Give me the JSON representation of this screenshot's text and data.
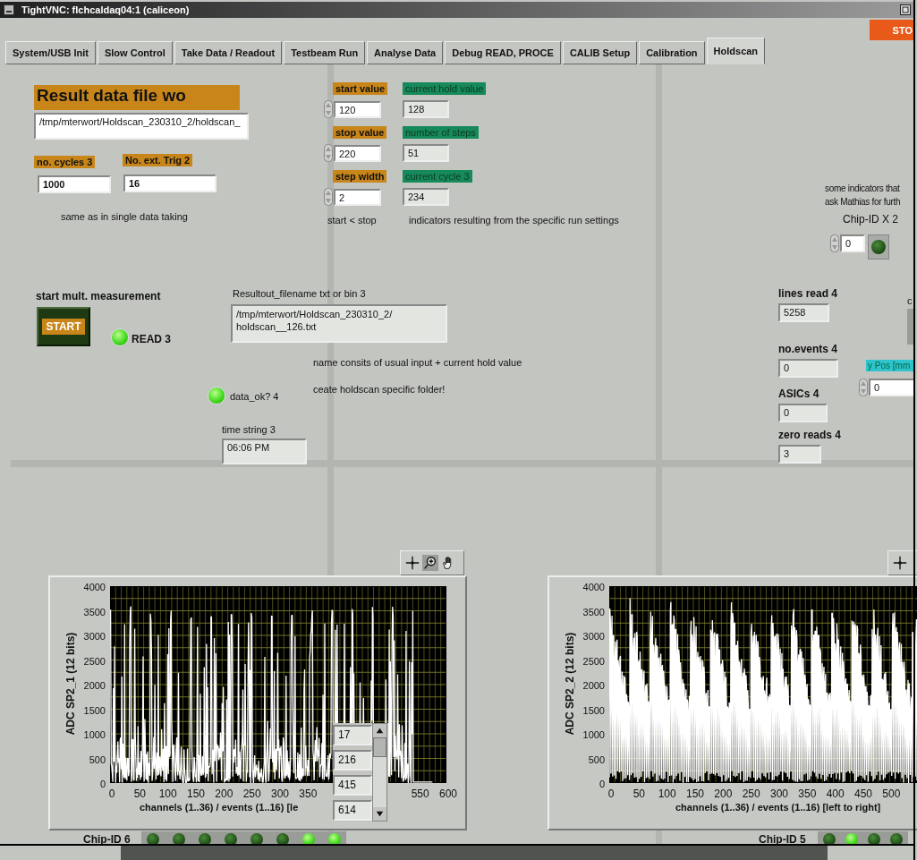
{
  "window": {
    "title": "TightVNC: flchcaldaq04:1 (caliceon)"
  },
  "tabs": [
    {
      "label": "System/USB Init",
      "selected": false
    },
    {
      "label": "Slow Control",
      "selected": false
    },
    {
      "label": "Take Data / Readout",
      "selected": false
    },
    {
      "label": "Testbeam Run",
      "selected": false
    },
    {
      "label": "Analyse Data",
      "selected": false
    },
    {
      "label": "Debug READ, PROCE",
      "selected": false
    },
    {
      "label": "CALIB Setup",
      "selected": false
    },
    {
      "label": "Calibration",
      "selected": false
    },
    {
      "label": "Holdscan",
      "selected": true
    }
  ],
  "stop_button": {
    "label": "STO"
  },
  "result_file": {
    "label": "Result data file wo",
    "value": "/tmp/mterwort/Holdscan_230310_2/holdscan_"
  },
  "no_cycles": {
    "label": "no. cycles 3",
    "value": "1000"
  },
  "ext_trig": {
    "label": "No. ext. Trig 2",
    "value": "16"
  },
  "note_same": "same as in single data taking",
  "scan_controls": [
    {
      "label": "start value",
      "value": "120"
    },
    {
      "label": "stop value",
      "value": "220"
    },
    {
      "label": "step width",
      "value": "2"
    }
  ],
  "scan_indicators": [
    {
      "label": "current hold value",
      "value": "128"
    },
    {
      "label": "number of steps",
      "value": "51"
    },
    {
      "label": "current cycle 3",
      "value": "234"
    }
  ],
  "note_start_stop": "start < stop",
  "note_indicators": "indicators resulting from the specific run settings",
  "start": {
    "label": "start mult. measurement",
    "button": "START"
  },
  "read_led": {
    "label": "READ 3",
    "on": true
  },
  "data_ok_led": {
    "label": "data_ok? 4",
    "on": true
  },
  "resultout": {
    "label": "Resultout_filename txt or bin 3",
    "lines": [
      "/tmp/mterwort/Holdscan_230310_2/",
      "holdscan__126.txt"
    ]
  },
  "notes_name": [
    "name consits of usual input + current hold value",
    "ceate holdscan specific folder!"
  ],
  "time_string": {
    "label": "time string 3",
    "value": "06:06 PM"
  },
  "right_note": [
    "some indicators that",
    "ask Mathias for furth"
  ],
  "chip_id_x": {
    "label": "Chip-ID X 2",
    "value": "0",
    "on": false
  },
  "counters": [
    {
      "label": "lines read 4",
      "value": "5258"
    },
    {
      "label": "no.events 4",
      "value": "0"
    },
    {
      "label": "ASICs 4",
      "value": "0"
    },
    {
      "label": "zero reads 4",
      "value": "3"
    }
  ],
  "cut_label": "c",
  "y_pos": {
    "label": "y Pos [mm",
    "value": "0"
  },
  "charts": [
    {
      "y_label": "ADC SP2_1 (12 bits)",
      "x_label": "channels (1..36) / events (1..16) [le",
      "yticks": [
        "4000",
        "3500",
        "3000",
        "2500",
        "2000",
        "1500",
        "1000",
        "500",
        "0"
      ],
      "xticks": [
        "0",
        "50",
        "100",
        "150",
        "200",
        "250",
        "300",
        "350"
      ],
      "xticks_end": [
        "550",
        "600"
      ],
      "chip_label": "Chip-ID 6",
      "chip_leds": [
        false,
        false,
        false,
        false,
        false,
        false,
        true,
        true
      ]
    },
    {
      "y_label": "ADC SP2_2 (12 bits)",
      "x_label": "channels (1..36) / events (1..16) [left to right]",
      "yticks": [
        "4000",
        "3500",
        "3000",
        "2500",
        "2000",
        "1500",
        "1000",
        "500",
        "0"
      ],
      "xticks": [
        "0",
        "50",
        "100",
        "150",
        "200",
        "250",
        "300",
        "350",
        "400",
        "450",
        "500"
      ],
      "chip_label": "Chip-ID 5",
      "chip_leds": [
        false,
        true,
        false,
        false
      ]
    }
  ],
  "buffer_list": {
    "items": [
      "17",
      "216",
      "415",
      "614"
    ]
  }
}
